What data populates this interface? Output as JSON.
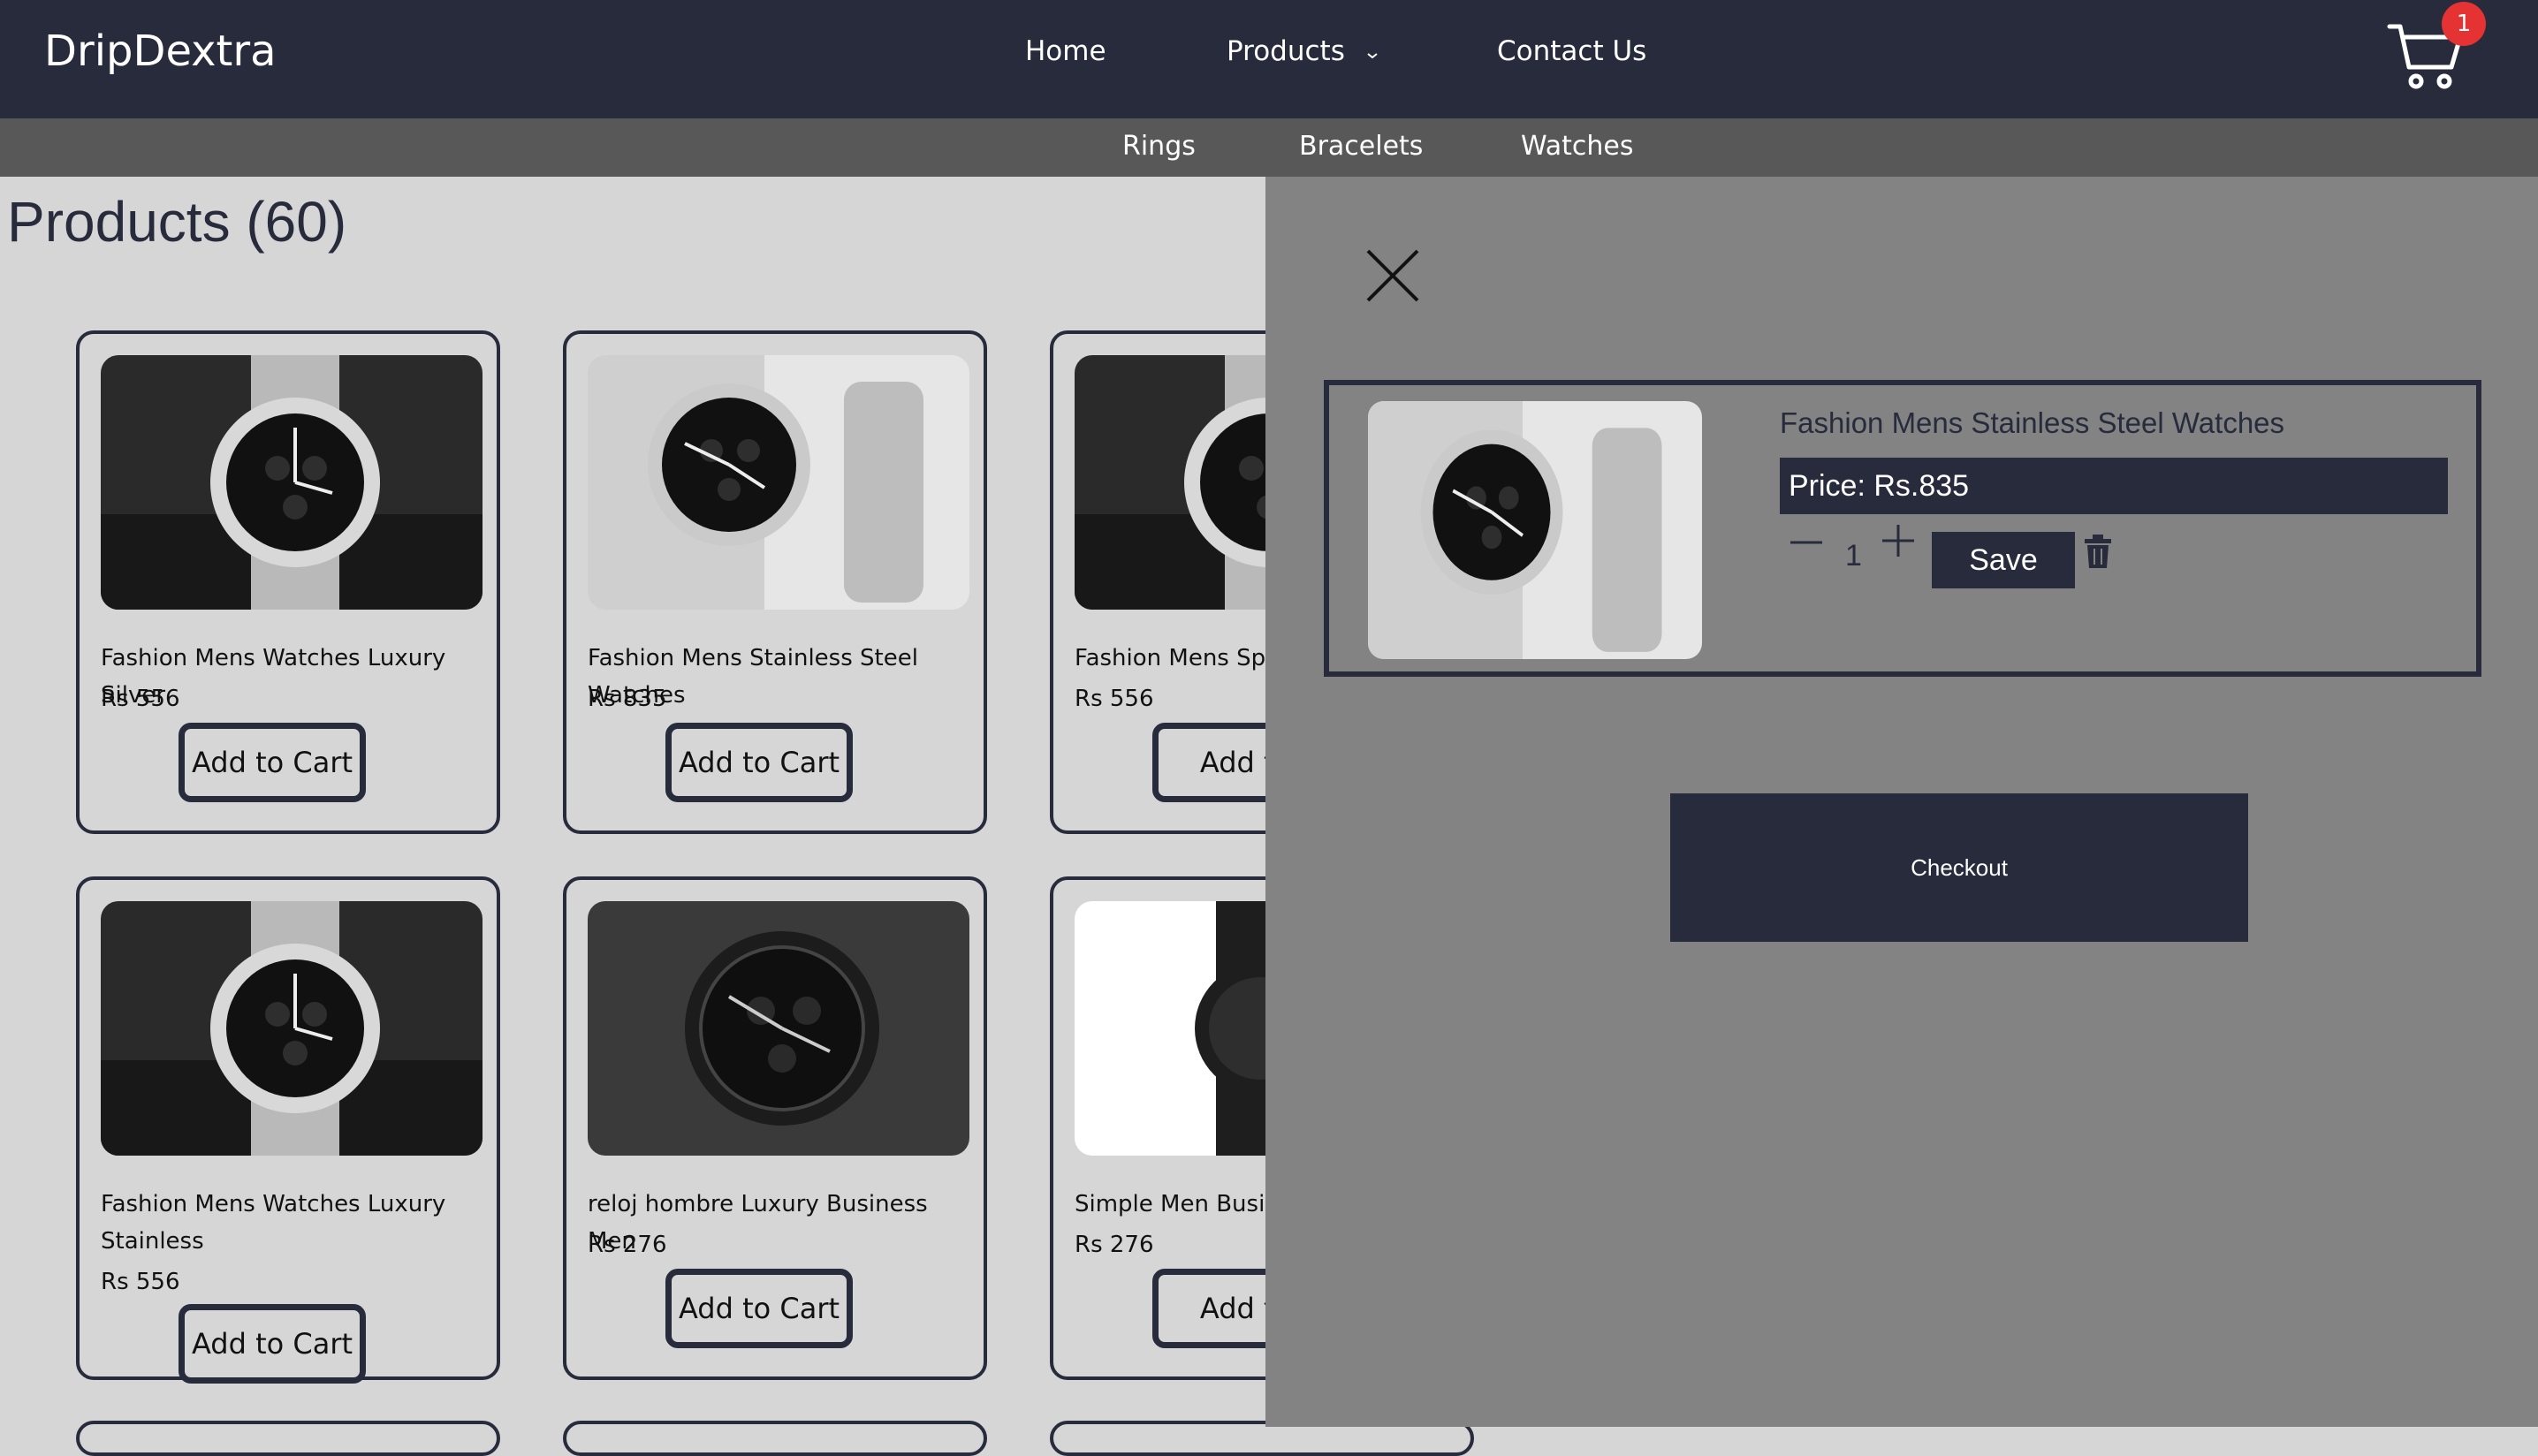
{
  "header": {
    "brand": "DripDextra",
    "nav": {
      "home": "Home",
      "products": "Products",
      "contact": "Contact Us"
    },
    "cart_count": "1"
  },
  "subnav": {
    "rings": "Rings",
    "bracelets": "Bracelets",
    "watches": "Watches"
  },
  "page": {
    "title": "Products (60)"
  },
  "products": [
    {
      "name": "Fashion Mens Watches Luxury Silver",
      "price": "Rs 556",
      "button": "Add to Cart"
    },
    {
      "name": "Fashion Mens Stainless Steel Watches",
      "price": "Rs 835",
      "button": "Add to Cart"
    },
    {
      "name": "Fashion Mens Sport",
      "price": "Rs 556",
      "button": "Add to"
    },
    {
      "name": "Fashion Mens Watches Luxury Stainless",
      "price": "Rs 556",
      "button": "Add to Cart"
    },
    {
      "name": "reloj hombre Luxury Business Men",
      "price": "Rs 276",
      "button": "Add to Cart"
    },
    {
      "name": "Simple Men Busines",
      "price": "Rs 276",
      "button": "Add to"
    }
  ],
  "cart": {
    "item": {
      "name": "Fashion Mens Stainless Steel Watches",
      "price": "Price: Rs.835",
      "quantity": "1",
      "save": "Save"
    },
    "checkout": "Checkout"
  },
  "colors": {
    "navy": "#272b3c",
    "badge": "#e53232",
    "overlay": "#838383"
  },
  "icons": [
    "cart-icon",
    "chevron-down-icon",
    "close-icon",
    "minus-icon",
    "plus-icon",
    "trash-icon"
  ]
}
